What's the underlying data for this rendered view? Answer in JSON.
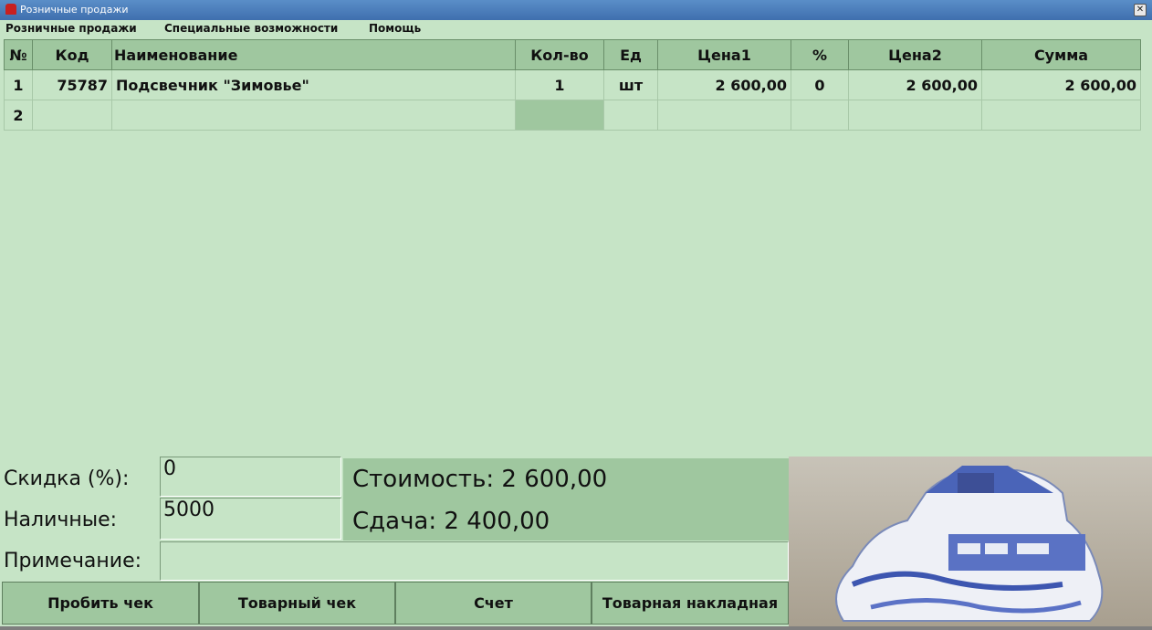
{
  "window": {
    "title": "Розничные продажи"
  },
  "menu": [
    {
      "label": "Розничные продажи"
    },
    {
      "label": "Специальные возможности"
    },
    {
      "label": "Помощь"
    }
  ],
  "table": {
    "columns": [
      "№",
      "Код",
      "Наименование",
      "Кол-во",
      "Ед",
      "Цена1",
      "%",
      "Цена2",
      "Сумма"
    ],
    "rows": [
      {
        "n": "1",
        "code": "75787",
        "name": "Подсвечник \"Зимовье\"",
        "qty": "1",
        "unit": "шт",
        "price1": "2 600,00",
        "pct": "0",
        "price2": "2 600,00",
        "sum": "2 600,00"
      },
      {
        "n": "2",
        "code": "",
        "name": "",
        "qty": "",
        "unit": "",
        "price1": "",
        "pct": "",
        "price2": "",
        "sum": ""
      }
    ]
  },
  "form": {
    "discount_label": "Скидка (%):",
    "discount_value": "0",
    "cash_label": "Наличные:",
    "cash_value": "5000",
    "note_label": "Примечание:",
    "note_value": ""
  },
  "totals": {
    "cost_text": "Стоимость: 2 600,00",
    "change_text": "Сдача: 2 400,00"
  },
  "buttons": {
    "print_check": "Пробить чек",
    "sales_receipt": "Товарный чек",
    "invoice": "Счет",
    "waybill": "Товарная накладная"
  },
  "colors": {
    "background": "#c6e4c6",
    "header": "#9fc79f"
  }
}
